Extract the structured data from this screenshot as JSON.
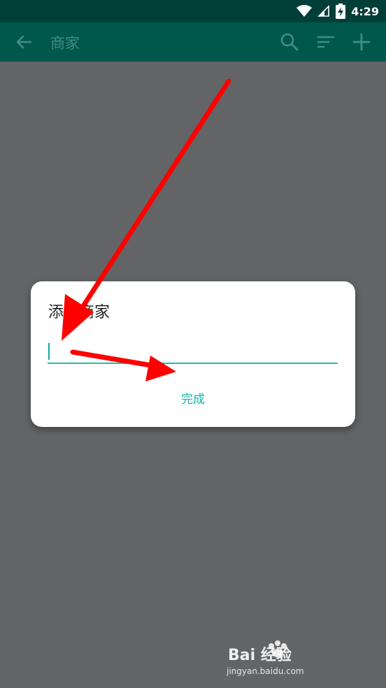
{
  "status": {
    "time": "4:29"
  },
  "app_bar": {
    "title": "商家"
  },
  "dialog": {
    "title": "添加商家",
    "input_value": "",
    "input_placeholder": "",
    "done_label": "完成"
  },
  "watermark": {
    "brand": "Bai 经验",
    "url": "jingyan.baidu.com"
  },
  "colors": {
    "accent": "#1fbfae",
    "app_bar": "#00574c",
    "scrim": "#636466",
    "annotation": "#ff0000"
  }
}
